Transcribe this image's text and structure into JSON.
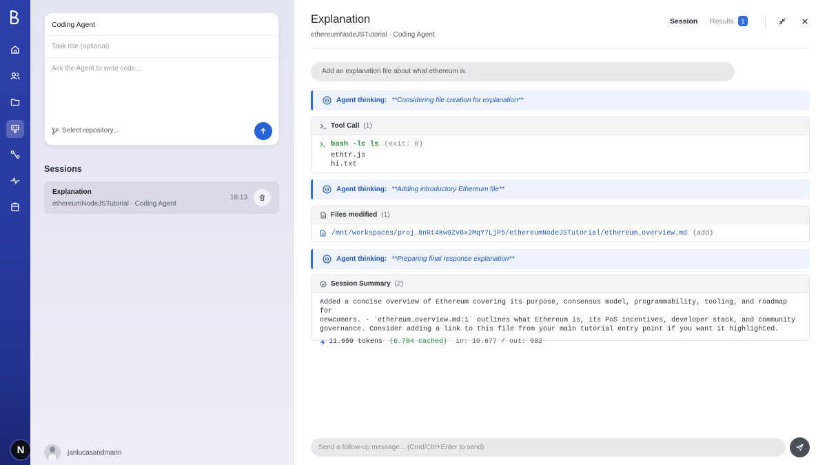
{
  "rail": {
    "nav_icons": [
      "home-icon",
      "users-icon",
      "folder-icon",
      "agent-icon",
      "workflow-icon",
      "activity-icon",
      "clipboard-icon"
    ],
    "active_index": 3,
    "bottom_badge": "N"
  },
  "composer": {
    "agent_label": "Coding Agent",
    "title_placeholder": "Task title (optional)",
    "prompt_placeholder": "Ask the Agent to write code...",
    "repo_placeholder": "Select repository..."
  },
  "sessions": {
    "heading": "Sessions",
    "items": [
      {
        "title": "Explanation",
        "subtitle": "ethereumNodeJSTutorial · Coding Agent",
        "time": "18:13"
      }
    ]
  },
  "user": {
    "name": "janlucasandmann"
  },
  "header": {
    "title": "Explanation",
    "subtitle": "ethereumNodeJSTutorial · Coding Agent",
    "tab_session": "Session",
    "tab_results": "Results",
    "results_count": "1"
  },
  "conversation": {
    "user_message": "Add an explanation file about what ethereum is.",
    "thinking_label": "Agent thinking:",
    "thinking_1": "**Considering file creation for explanation**",
    "thinking_2": "**Adding introductory Ethereum file**",
    "thinking_3": "**Preparing final response explanation**",
    "tool_call": {
      "title": "Tool Call",
      "count": "(1)",
      "command": "bash -lc ls",
      "exit": "(exit: 0)",
      "output_1": "ethtr.js",
      "output_2": "hi.txt"
    },
    "files": {
      "title": "Files modified",
      "count": "(1)",
      "path": "/mnt/workspaces/proj_8nRt4Kw9ZvBx2MqY7LjP5/ethereumNodeJSTutorial/ethereum_overview.md",
      "action": "(add)"
    },
    "summary": {
      "title": "Session Summary",
      "count": "(2)",
      "line_1": "Added a concise overview of Ethereum covering its purpose, consensus model, programmability, tooling, and roadmap for",
      "line_2": "newcomers. - `ethereum_overview.md:1` outlines what Ethereum is, its PoS incentives, developer stack, and community",
      "line_3": "governance. Consider adding a link to this file from your main tutorial entry point if you want it highlighted.",
      "tokens": "11.659 tokens",
      "cached": "(6.784 cached)",
      "io": "in: 10.677 / out: 982"
    }
  },
  "footer": {
    "followup_placeholder": "Send a follow-up message... (Cmd/Ctrl+Enter to send)"
  },
  "colors": {
    "accent": "#2d6fe0",
    "thinking_bg": "#eef3fd",
    "rail_top": "#2c3fa8",
    "success": "#2c8a3e"
  }
}
